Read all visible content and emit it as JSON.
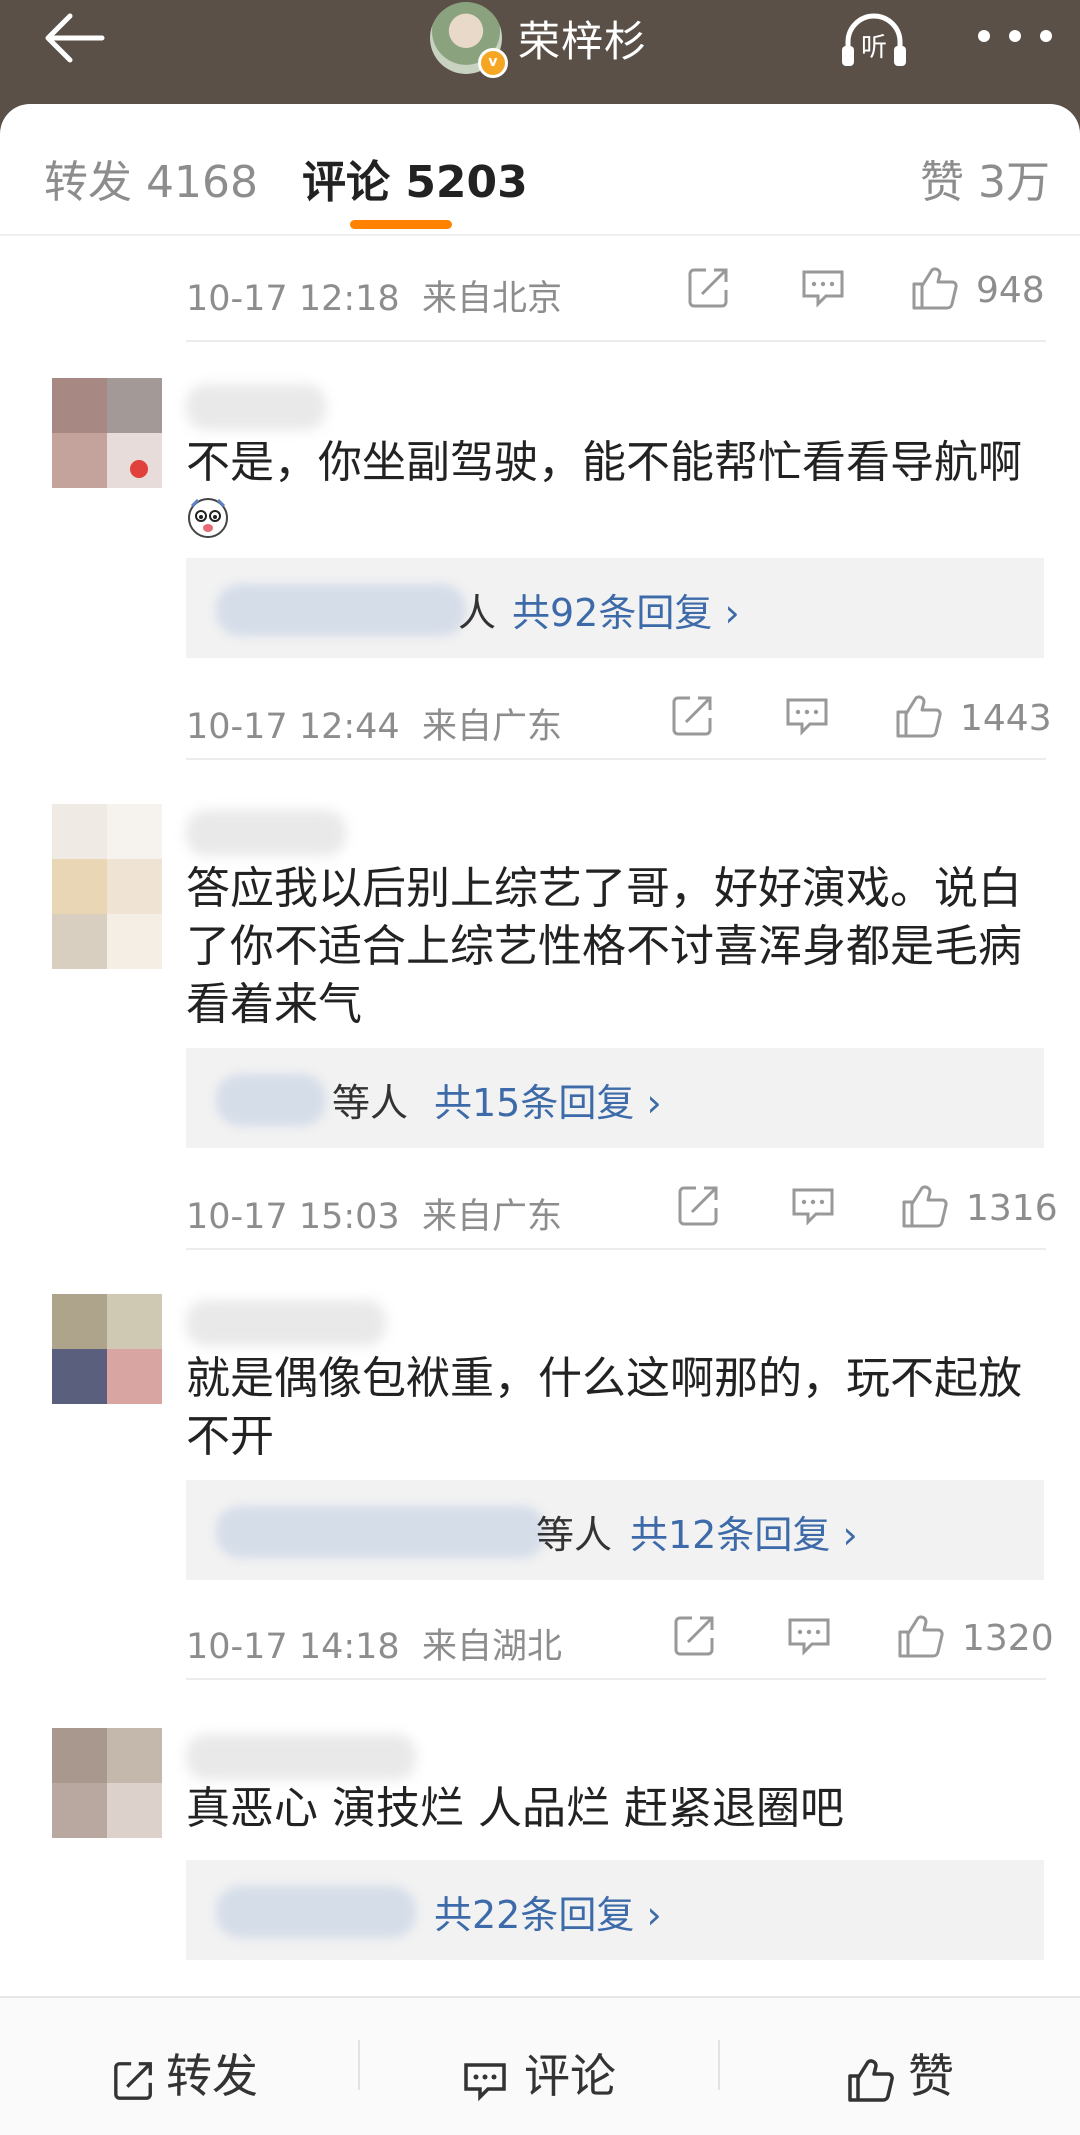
{
  "header": {
    "title": "荣梓杉",
    "verified_badge": "v",
    "back_icon": "back-arrow-icon",
    "listen_label": "听",
    "more_icon": "more-dots-icon"
  },
  "tabs": [
    {
      "label": "转发 4168"
    },
    {
      "label": "评论 5203"
    },
    {
      "label": "赞 3万"
    }
  ],
  "top_meta": {
    "time": "10-17 12:18",
    "location": "来自北京",
    "likes": "948"
  },
  "comments": [
    {
      "text": "不是，你坐副驾驶，能不能帮忙看看导航啊",
      "reply_suffix": "人",
      "reply_link": "共92条回复",
      "time": "10-17 12:44",
      "location": "来自广东",
      "likes": "1443"
    },
    {
      "text": "答应我以后别上综艺了哥，好好演戏。说白了你不适合上综艺性格不讨喜浑身都是毛病看着来气",
      "reply_suffix": "等人",
      "reply_link": "共15条回复",
      "time": "10-17 15:03",
      "location": "来自广东",
      "likes": "1316"
    },
    {
      "text": "就是偶像包袱重，什么这啊那的，玩不起放不开",
      "reply_suffix": "等人",
      "reply_link": "共12条回复",
      "time": "10-17 14:18",
      "location": "来自湖北",
      "likes": "1320"
    },
    {
      "text": "真恶心 演技烂 人品烂 赶紧退圈吧",
      "reply_suffix": "",
      "reply_link": "共22条回复"
    }
  ],
  "bottom_bar": {
    "repost": "转发",
    "comment": "评论",
    "like": "赞"
  },
  "colors": {
    "header_bg": "#5a5048",
    "accent_orange": "#ff8200",
    "link_blue": "#3d6aa8",
    "meta_gray": "#8d8d8d"
  }
}
